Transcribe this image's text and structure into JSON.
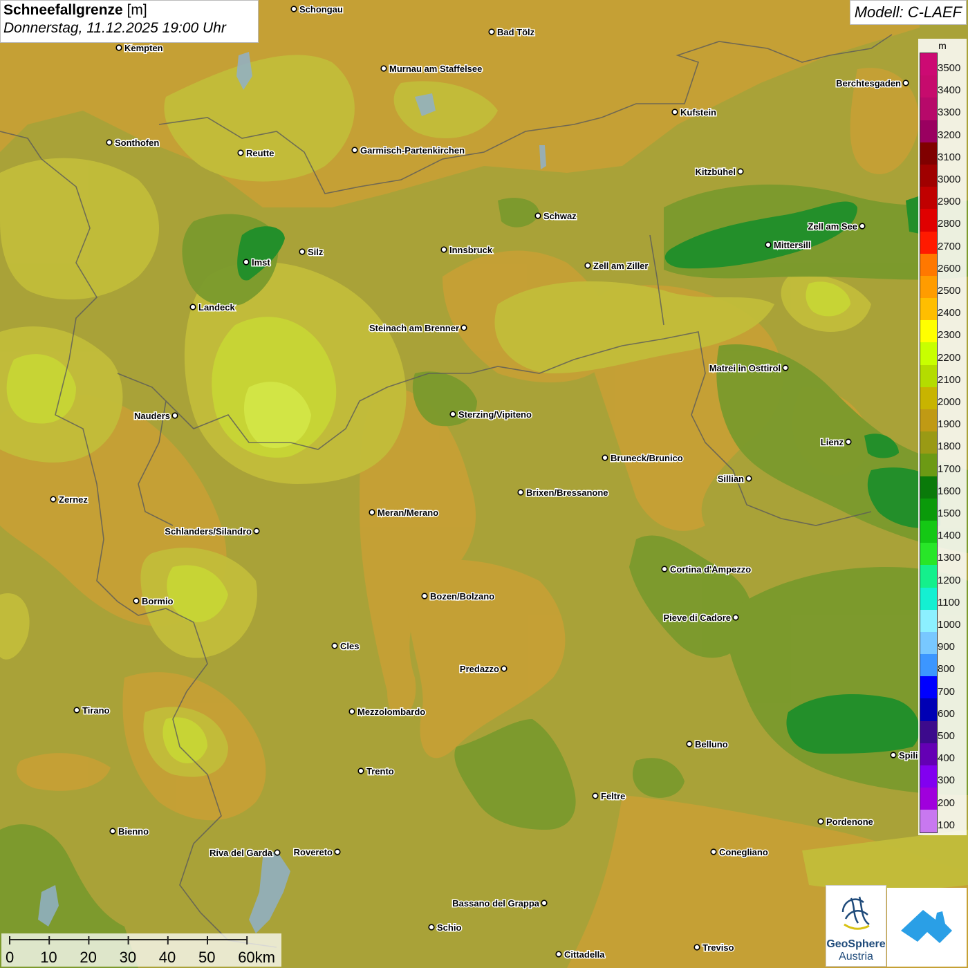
{
  "header": {
    "title_bold": "Schneefallgrenze",
    "title_unit": "[m]",
    "datetime": "Donnerstag, 11.12.2025 19:00 Uhr",
    "model": "Modell: C-LAEF"
  },
  "legend": {
    "unit": "m",
    "levels": [
      {
        "value": "3500",
        "color": "#cc0a73"
      },
      {
        "value": "3400",
        "color": "#c60b6d"
      },
      {
        "value": "3300",
        "color": "#b7096a"
      },
      {
        "value": "3200",
        "color": "#9a0060"
      },
      {
        "value": "3100",
        "color": "#800000"
      },
      {
        "value": "3000",
        "color": "#a00000"
      },
      {
        "value": "2900",
        "color": "#c00000"
      },
      {
        "value": "2800",
        "color": "#e00000"
      },
      {
        "value": "2700",
        "color": "#ff1a00"
      },
      {
        "value": "2600",
        "color": "#ff7800"
      },
      {
        "value": "2500",
        "color": "#ff9c00"
      },
      {
        "value": "2400",
        "color": "#ffbe00"
      },
      {
        "value": "2300",
        "color": "#ffff00"
      },
      {
        "value": "2200",
        "color": "#c8ff00"
      },
      {
        "value": "2100",
        "color": "#b4dc00"
      },
      {
        "value": "2000",
        "color": "#c8b400"
      },
      {
        "value": "1900",
        "color": "#c09a14"
      },
      {
        "value": "1800",
        "color": "#9a9a14"
      },
      {
        "value": "1700",
        "color": "#6c9a14"
      },
      {
        "value": "1600",
        "color": "#0a7a0a"
      },
      {
        "value": "1500",
        "color": "#0a9a0a"
      },
      {
        "value": "1400",
        "color": "#14c814"
      },
      {
        "value": "1300",
        "color": "#28e628"
      },
      {
        "value": "1200",
        "color": "#14f08c"
      },
      {
        "value": "1100",
        "color": "#14f0d2"
      },
      {
        "value": "1000",
        "color": "#8cf0ff"
      },
      {
        "value": "900",
        "color": "#78c8ff"
      },
      {
        "value": "800",
        "color": "#3c96ff"
      },
      {
        "value": "700",
        "color": "#0000ff"
      },
      {
        "value": "600",
        "color": "#0000b4"
      },
      {
        "value": "500",
        "color": "#3c0a8c"
      },
      {
        "value": "400",
        "color": "#6400b4"
      },
      {
        "value": "300",
        "color": "#8200f0"
      },
      {
        "value": "200",
        "color": "#a000dc"
      },
      {
        "value": "100",
        "color": "#c878f0"
      }
    ]
  },
  "cities": [
    {
      "name": "Schongau",
      "side": "right"
    },
    {
      "name": "Bad Tölz",
      "side": "right"
    },
    {
      "name": "Kempten",
      "side": "right"
    },
    {
      "name": "Murnau am Staffelsee",
      "side": "right"
    },
    {
      "name": "Berchtesgaden",
      "side": "left"
    },
    {
      "name": "Kufstein",
      "side": "right"
    },
    {
      "name": "Sonthofen",
      "side": "right"
    },
    {
      "name": "Reutte",
      "side": "right"
    },
    {
      "name": "Garmisch-Partenkirchen",
      "side": "right"
    },
    {
      "name": "Kitzbühel",
      "side": "left"
    },
    {
      "name": "Schwaz",
      "side": "right"
    },
    {
      "name": "Zell am See",
      "side": "left"
    },
    {
      "name": "Mittersill",
      "side": "right"
    },
    {
      "name": "Innsbruck",
      "side": "right"
    },
    {
      "name": "Imst",
      "side": "right"
    },
    {
      "name": "Silz",
      "side": "right"
    },
    {
      "name": "Zell am Ziller",
      "side": "right"
    },
    {
      "name": "Landeck",
      "side": "right"
    },
    {
      "name": "Steinach am Brenner",
      "side": "left"
    },
    {
      "name": "Matrei in Osttirol",
      "side": "left"
    },
    {
      "name": "Nauders",
      "side": "left"
    },
    {
      "name": "Sterzing/Vipiteno",
      "side": "right"
    },
    {
      "name": "Lienz",
      "side": "left"
    },
    {
      "name": "Bruneck/Brunico",
      "side": "right"
    },
    {
      "name": "Sillian",
      "side": "left"
    },
    {
      "name": "Brixen/Bressanone",
      "side": "right"
    },
    {
      "name": "Zernez",
      "side": "right"
    },
    {
      "name": "Meran/Merano",
      "side": "right"
    },
    {
      "name": "Schlanders/Silandro",
      "side": "left"
    },
    {
      "name": "Cortina d'Ampezzo",
      "side": "right"
    },
    {
      "name": "Bozen/Bolzano",
      "side": "right"
    },
    {
      "name": "Bormio",
      "side": "right"
    },
    {
      "name": "Pieve di Cadore",
      "side": "left"
    },
    {
      "name": "Cles",
      "side": "right"
    },
    {
      "name": "Predazzo",
      "side": "left"
    },
    {
      "name": "Tirano",
      "side": "right"
    },
    {
      "name": "Mezzolombardo",
      "side": "right"
    },
    {
      "name": "Belluno",
      "side": "right"
    },
    {
      "name": "Spili",
      "side": "right"
    },
    {
      "name": "Trento",
      "side": "right"
    },
    {
      "name": "Feltre",
      "side": "right"
    },
    {
      "name": "Pordenone",
      "side": "right"
    },
    {
      "name": "Bienno",
      "side": "right"
    },
    {
      "name": "Riva del Garda",
      "side": "left"
    },
    {
      "name": "Rovereto",
      "side": "left"
    },
    {
      "name": "Conegliano",
      "side": "right"
    },
    {
      "name": "Bassano del Grappa",
      "side": "left"
    },
    {
      "name": "Schio",
      "side": "right"
    },
    {
      "name": "Treviso",
      "side": "right"
    },
    {
      "name": "Cittadella",
      "side": "right"
    }
  ],
  "scale": {
    "ticks": [
      "0",
      "10",
      "20",
      "30",
      "40",
      "50",
      "60km"
    ]
  },
  "logos": {
    "geosphere_line1": "GeoSphere",
    "geosphere_line2": "Austria"
  }
}
